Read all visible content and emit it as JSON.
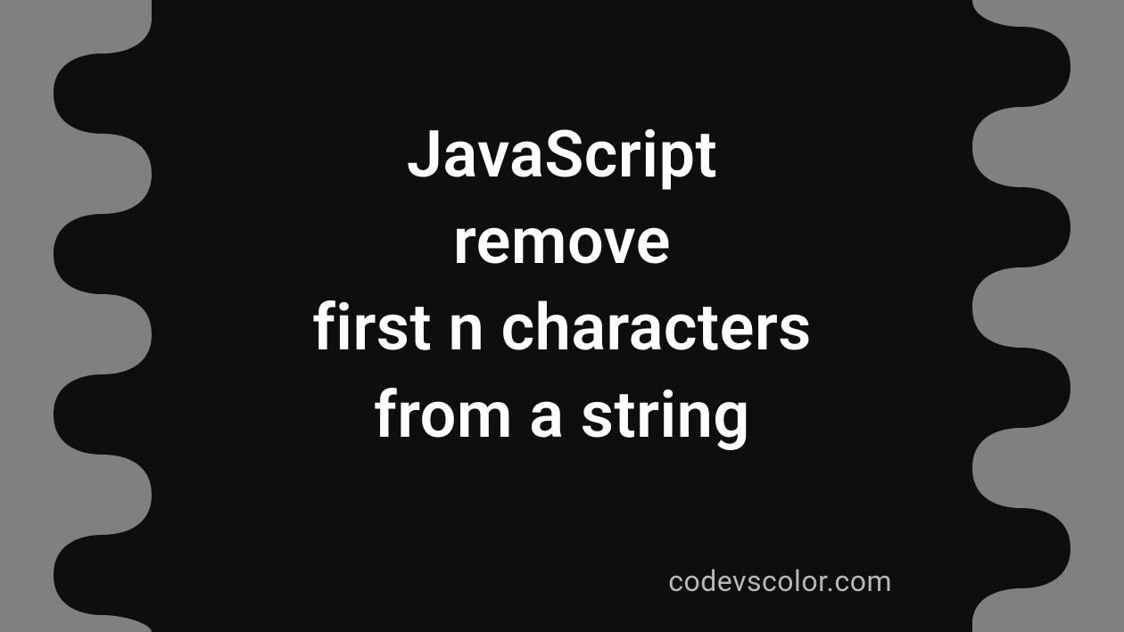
{
  "title": {
    "line1": "JavaScript",
    "line2": "remove",
    "line3": "first n characters",
    "line4": "from a string"
  },
  "watermark": "codevscolor.com",
  "colors": {
    "background": "#808080",
    "blob": "#0e0e0e",
    "text": "#ffffff",
    "watermark": "#b8b8b8"
  }
}
